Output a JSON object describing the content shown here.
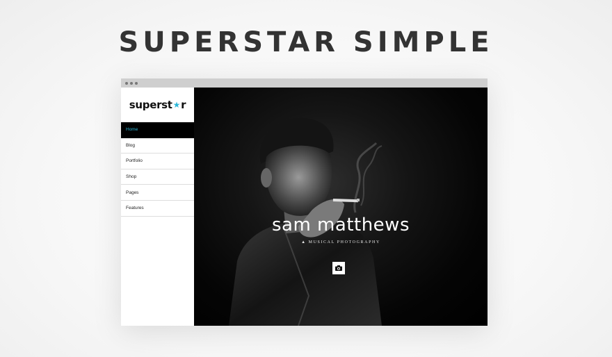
{
  "headline": "SUPERSTAR SIMPLE",
  "brand": {
    "prefix": "superst",
    "star": "★",
    "suffix": "r"
  },
  "nav": [
    {
      "label": "Home",
      "active": true
    },
    {
      "label": "Blog"
    },
    {
      "label": "Portfolio"
    },
    {
      "label": "Shop"
    },
    {
      "label": "Pages"
    },
    {
      "label": "Features"
    }
  ],
  "hero": {
    "title": "sam matthews",
    "tagline": "MUSICAL PHOTOGRAPHY",
    "tagline_icon": "pin-icon",
    "button_icon": "camera-icon"
  },
  "colors": {
    "accent": "#2bb7d8",
    "headline": "#333333",
    "hero_bg": "#000000",
    "nav_active_bg": "#000000"
  }
}
